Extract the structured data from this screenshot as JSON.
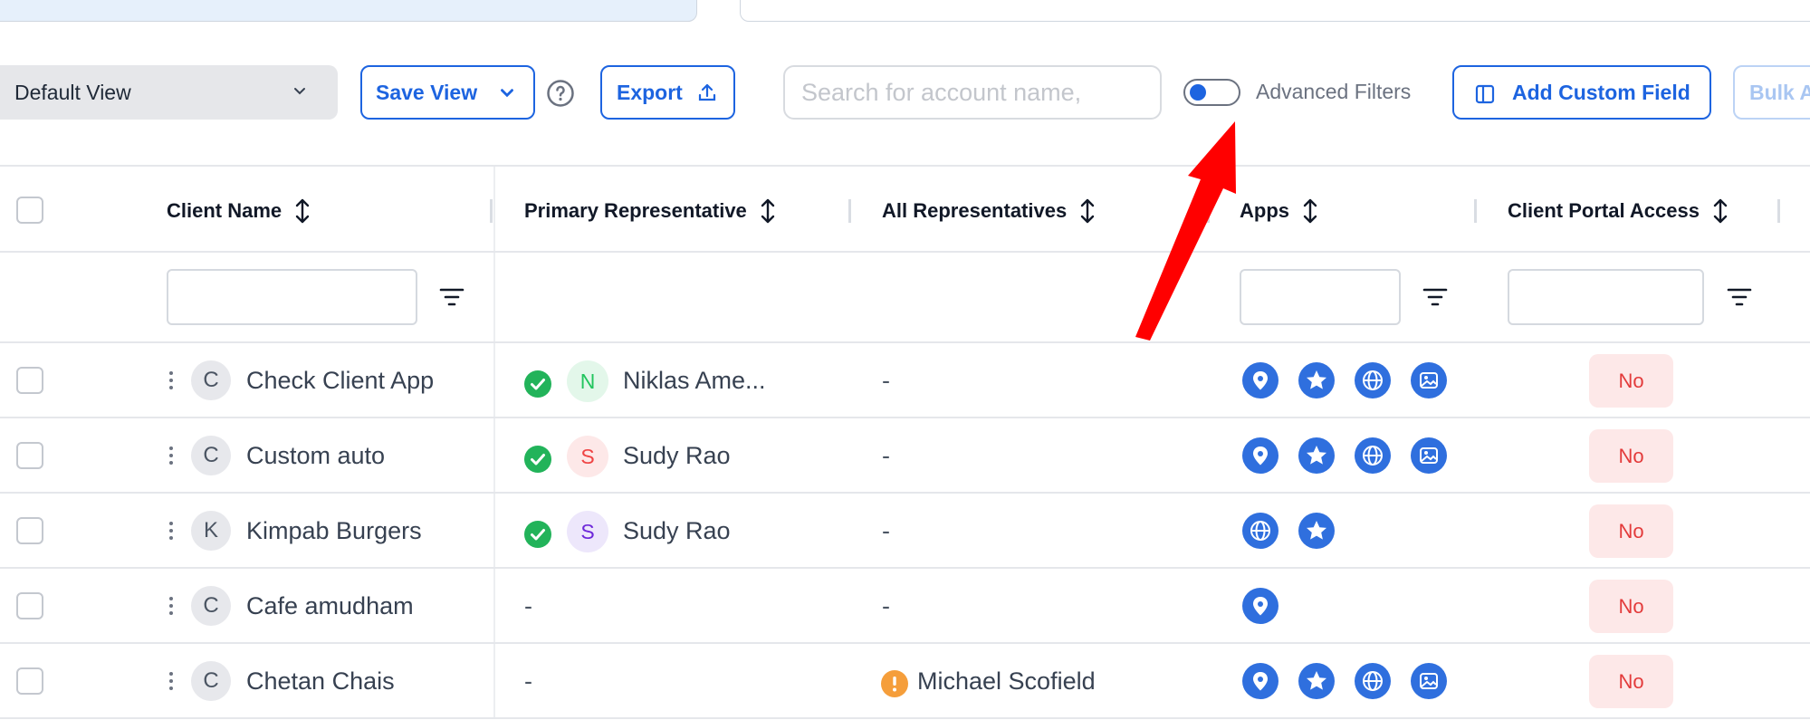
{
  "toolbar": {
    "view_select_value": "Default View",
    "save_view_label": "Save View",
    "export_label": "Export",
    "search_placeholder": "Search for account name,",
    "advanced_filters_label": "Advanced Filters",
    "advanced_filters_enabled": false,
    "add_custom_field_label": "Add Custom Field",
    "bulk_action_label": "Bulk A"
  },
  "table": {
    "columns": [
      "Client Name",
      "Primary Representative",
      "All Representatives",
      "Apps",
      "Client Portal Access"
    ],
    "rows": [
      {
        "initial": "C",
        "client": "Check Client App",
        "primary_initial": "N",
        "primary_name": "Niklas Ame...",
        "primary_color": "#22c55e",
        "primary_bg": "#e3f7ea",
        "all_reps": "-",
        "all_reps_warn": false,
        "apps": [
          "location-pin-icon",
          "star-icon",
          "globe-icon",
          "image-icon"
        ],
        "portal": "No"
      },
      {
        "initial": "C",
        "client": "Custom auto",
        "primary_initial": "S",
        "primary_name": "Sudy Rao",
        "primary_color": "#ef4444",
        "primary_bg": "#fde8e8",
        "all_reps": "-",
        "all_reps_warn": false,
        "apps": [
          "location-pin-icon",
          "star-icon",
          "globe-icon",
          "image-icon"
        ],
        "portal": "No"
      },
      {
        "initial": "K",
        "client": "Kimpab Burgers",
        "primary_initial": "S",
        "primary_name": "Sudy Rao",
        "primary_color": "#6d28d9",
        "primary_bg": "#ede7fb",
        "all_reps": "-",
        "all_reps_warn": false,
        "apps": [
          "globe-icon",
          "star-icon"
        ],
        "portal": "No"
      },
      {
        "initial": "C",
        "client": "Cafe amudham",
        "primary_initial": "",
        "primary_name": "-",
        "primary_color": "",
        "primary_bg": "",
        "all_reps": "-",
        "all_reps_warn": false,
        "apps": [
          "location-pin-icon"
        ],
        "portal": "No"
      },
      {
        "initial": "C",
        "client": "Chetan Chais",
        "primary_initial": "",
        "primary_name": "-",
        "primary_color": "",
        "primary_bg": "",
        "all_reps": "Michael Scofield",
        "all_reps_warn": true,
        "apps": [
          "location-pin-icon",
          "star-icon",
          "globe-icon",
          "image-icon"
        ],
        "portal": "No"
      }
    ]
  },
  "colors": {
    "accent": "#1d64e0",
    "app_icon": "#2f6fde",
    "danger": "#e33b3b",
    "annotation_arrow": "#ff0000"
  }
}
